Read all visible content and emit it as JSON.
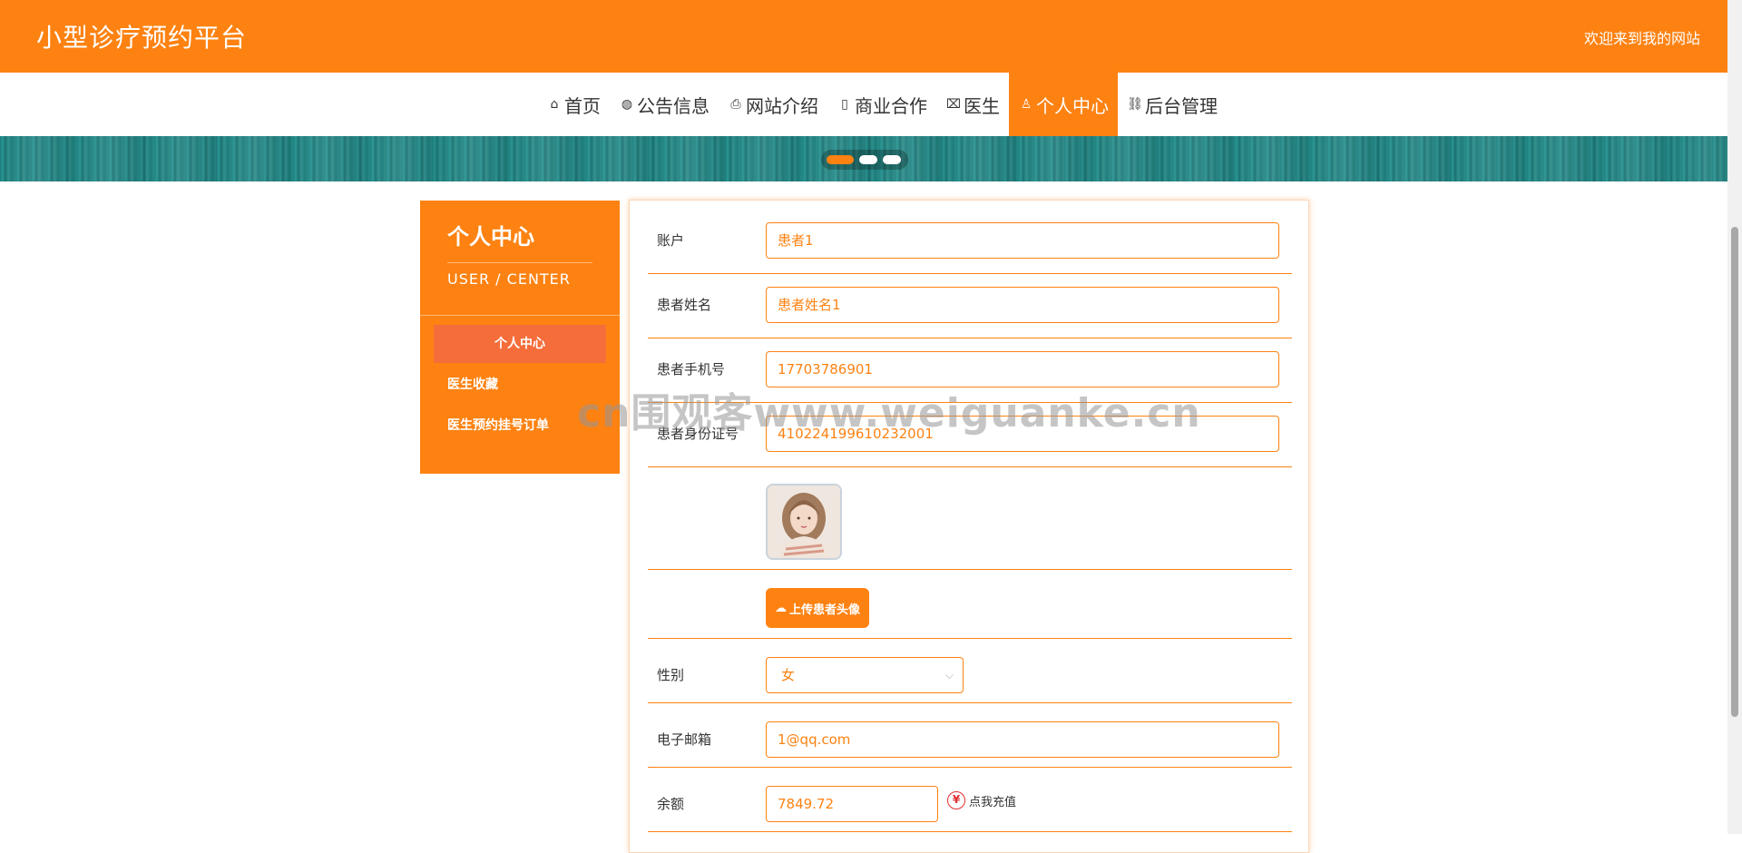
{
  "header": {
    "title": "小型诊疗预约平台",
    "welcome": "欢迎来到我的网站"
  },
  "nav": {
    "items": [
      {
        "label": "首页",
        "icon": "home-icon",
        "glyph": "⌂"
      },
      {
        "label": "公告信息",
        "icon": "globe-icon",
        "glyph": "◍"
      },
      {
        "label": "网站介绍",
        "icon": "printer-icon",
        "glyph": "⎙"
      },
      {
        "label": "商业合作",
        "icon": "document-icon",
        "glyph": "▯"
      },
      {
        "label": "医生",
        "icon": "gift-icon",
        "glyph": "⌧"
      },
      {
        "label": "个人中心",
        "icon": "user-icon",
        "glyph": "♙"
      },
      {
        "label": "后台管理",
        "icon": "link-icon",
        "glyph": "⛓"
      }
    ],
    "active": "个人中心"
  },
  "banner": {
    "slides": 3,
    "active_slide": 1
  },
  "sidebar": {
    "title": "个人中心",
    "subtitle": "USER / CENTER",
    "items": [
      {
        "label": "个人中心"
      },
      {
        "label": "医生收藏"
      },
      {
        "label": "医生预约挂号订单"
      }
    ]
  },
  "form": {
    "account": {
      "label": "账户",
      "value": "患者1"
    },
    "name": {
      "label": "患者姓名",
      "value": "患者姓名1"
    },
    "phone": {
      "label": "患者手机号",
      "value": "17703786901"
    },
    "id_card": {
      "label": "患者身份证号",
      "value": "410224199610232001"
    },
    "upload_label": "上传患者头像",
    "gender": {
      "label": "性别",
      "value": "女"
    },
    "email": {
      "label": "电子邮箱",
      "value": "1@qq.com"
    },
    "balance": {
      "label": "余额",
      "value": "7849.72",
      "recharge": "点我充值"
    }
  },
  "watermark": "cn围观客www.weiguanke.cn",
  "colors": {
    "primary": "#fd8212",
    "sidebar_active": "#f56d3a",
    "banner": "#1c7f7d"
  }
}
